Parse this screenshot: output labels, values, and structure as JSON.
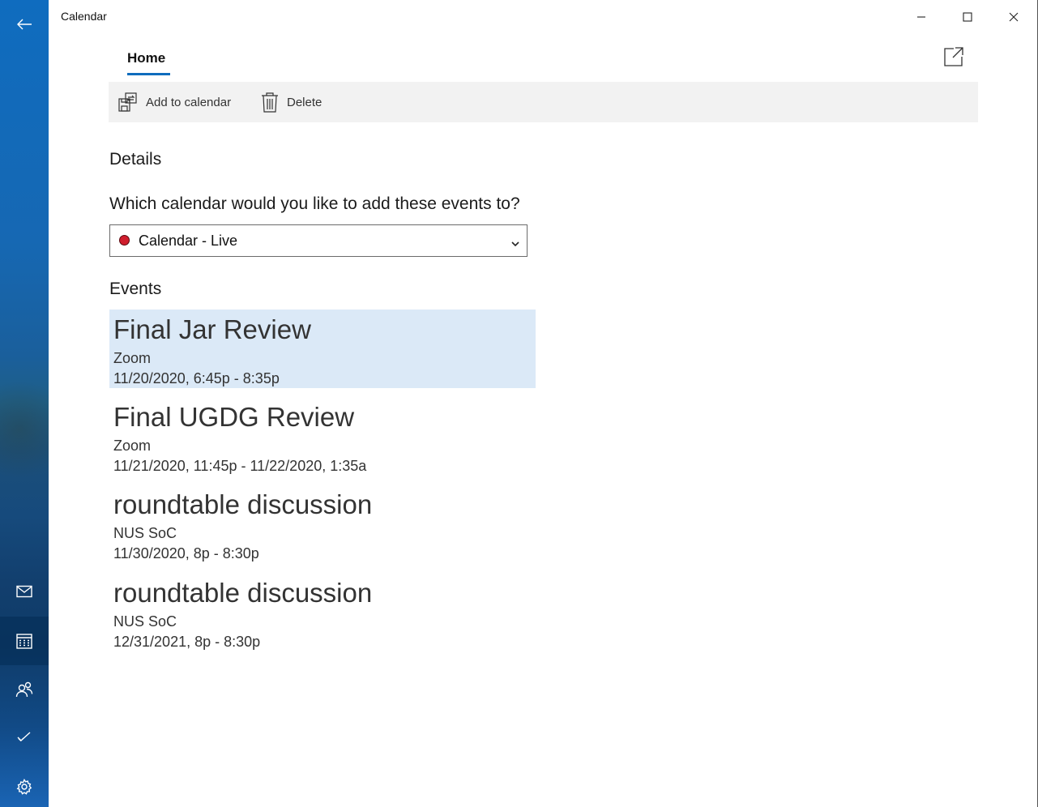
{
  "app": {
    "title": "Calendar"
  },
  "nav": {
    "back_icon": "arrow-left-icon",
    "items": [
      {
        "name": "mail",
        "icon": "envelope-icon",
        "active": false
      },
      {
        "name": "calendar",
        "icon": "calendar-icon",
        "active": true
      },
      {
        "name": "people",
        "icon": "people-icon",
        "active": false
      },
      {
        "name": "todo",
        "icon": "checkmark-icon",
        "active": false
      },
      {
        "name": "settings",
        "icon": "gear-icon",
        "active": false
      }
    ]
  },
  "tabs": [
    {
      "label": "Home",
      "selected": true
    }
  ],
  "toolbar": {
    "add_label": "Add to calendar",
    "delete_label": "Delete"
  },
  "details": {
    "heading": "Details",
    "question": "Which calendar would you like to add these events to?",
    "calendar_select": {
      "value": "Calendar - Live",
      "color": "#d01e2d"
    }
  },
  "events_section": {
    "heading": "Events",
    "items": [
      {
        "title": "Final Jar Review",
        "location": "Zoom",
        "time": "11/20/2020, 6:45p - 8:35p",
        "selected": true
      },
      {
        "title": "Final UGDG Review",
        "location": "Zoom",
        "time": "11/21/2020, 11:45p - 11/22/2020, 1:35a",
        "selected": false
      },
      {
        "title": "roundtable discussion",
        "location": "NUS SoC",
        "time": "11/30/2020, 8p - 8:30p",
        "selected": false
      },
      {
        "title": "roundtable discussion",
        "location": "NUS SoC",
        "time": "12/31/2021, 8p - 8:30p",
        "selected": false
      }
    ]
  },
  "colors": {
    "accent": "#0f6cbd",
    "selected_bg": "#dbe9f7",
    "toolbar_bg": "#f2f2f2"
  }
}
